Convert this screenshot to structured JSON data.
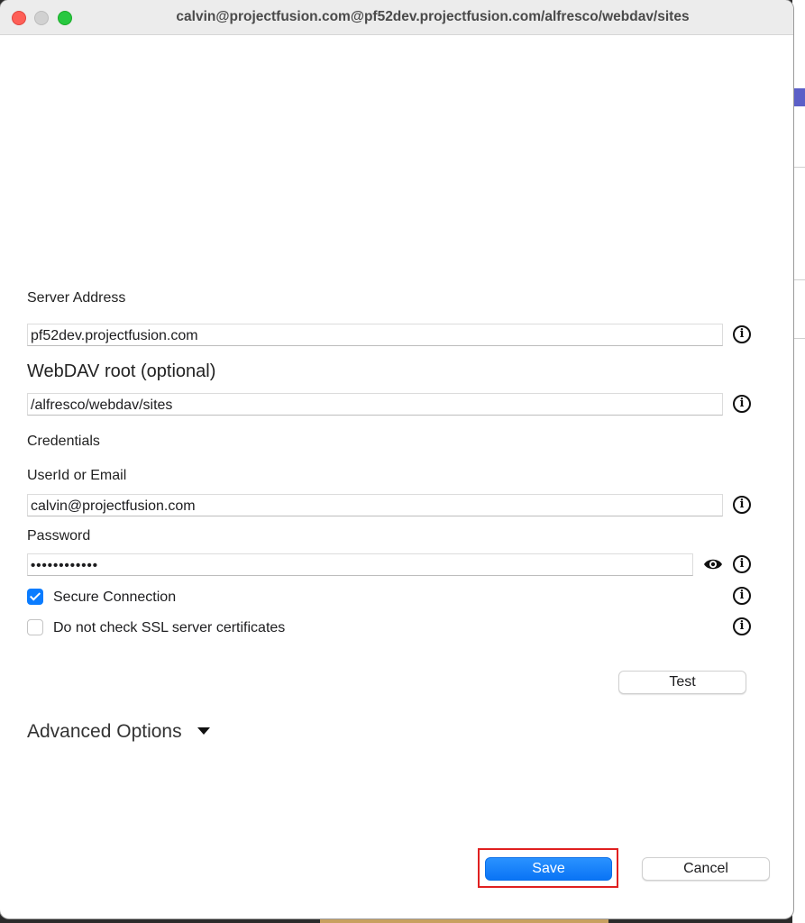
{
  "window": {
    "title": "calvin@projectfusion.com@pf52dev.projectfusion.com/alfresco/webdav/sites"
  },
  "form": {
    "server_address_label": "Server Address",
    "server_address_value": "pf52dev.projectfusion.com",
    "webdav_root_label": "WebDAV root (optional)",
    "webdav_root_value": "/alfresco/webdav/sites",
    "credentials_label": "Credentials",
    "userid_label": "UserId or Email",
    "userid_value": "calvin@projectfusion.com",
    "password_label": "Password",
    "password_value": "••••••••••••",
    "secure_connection_label": "Secure Connection",
    "secure_connection_checked": true,
    "ssl_check_label": "Do not check SSL server certificates",
    "ssl_check_checked": false,
    "test_button": "Test",
    "advanced_options_label": "Advanced Options"
  },
  "footer": {
    "save_button": "Save",
    "cancel_button": "Cancel"
  },
  "icons": {
    "info": "i",
    "info_icon": "info-circle-icon",
    "eye_icon": "eye-icon",
    "caret_icon": "caret-down-icon"
  },
  "colors": {
    "primary": "#0a7cff",
    "highlight": "#e02020"
  }
}
